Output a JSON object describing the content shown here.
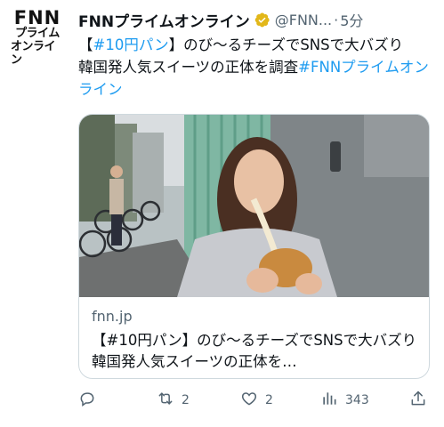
{
  "tweet": {
    "avatar": {
      "logo_main": "FNN",
      "logo_line2": "プライム",
      "logo_line3": "オンライン"
    },
    "display_name": "FNNプライムオンライン",
    "verified_icon": "verified-badge-icon",
    "handle": "@FNN...",
    "separator": "·",
    "time": "5分",
    "text_open_bracket": "【",
    "text_tag": "#10円パン",
    "text_rest": "】のび～るチーズでSNSで大バズり　韓国発人気スイーツの正体を調査",
    "text_link": "#FNNプライムオンライン"
  },
  "card": {
    "image_alt": "woman eating stretchy cheese bread",
    "domain": "fnn.jp",
    "title": "【#10円パン】のび～るチーズでSNSで大バズり　韓国発人気スイーツの正体を…"
  },
  "actions": {
    "reply": {
      "icon": "reply-icon",
      "count": ""
    },
    "retweet": {
      "icon": "retweet-icon",
      "count": "2"
    },
    "like": {
      "icon": "heart-icon",
      "count": "2"
    },
    "views": {
      "icon": "views-icon",
      "count": "343"
    },
    "share": {
      "icon": "share-icon",
      "count": ""
    }
  },
  "colors": {
    "accent": "#1d9bf0",
    "secondary_text": "#536471",
    "border": "#cfd9de"
  }
}
